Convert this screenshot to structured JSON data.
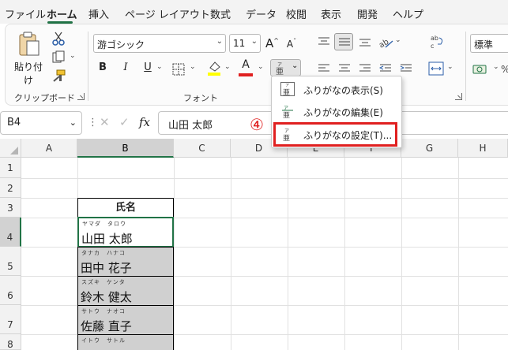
{
  "tabs": [
    "ファイル",
    "ホーム",
    "挿入",
    "ページ レイアウト",
    "数式",
    "データ",
    "校閲",
    "表示",
    "開発",
    "ヘルプ"
  ],
  "active_tab": "ホーム",
  "ribbon": {
    "clipboard": {
      "paste_label": "貼り付け",
      "group_label": "クリップボード"
    },
    "font": {
      "font_name": "游ゴシック",
      "font_size": "11",
      "group_label": "フォント",
      "bold": "B",
      "italic": "I",
      "underline": "U",
      "grow": "A",
      "shrink": "A",
      "font_color": "A"
    },
    "number_format": "標準",
    "accent_color": "#217346",
    "highlight_color": "#ffff00",
    "font_color_swatch": "#e02020"
  },
  "furigana_menu": {
    "items": [
      {
        "label": "ふりがなの表示(S)"
      },
      {
        "label": "ふりがなの編集(E)"
      },
      {
        "label": "ふりがなの設定(T)..."
      }
    ],
    "step_number": "④"
  },
  "formula_bar": {
    "name_box": "B4",
    "cancel": "✕",
    "enter": "✓",
    "fx": "fx",
    "value": "山田 太郎"
  },
  "columns": [
    "A",
    "B",
    "C",
    "D",
    "E",
    "F",
    "G",
    "H"
  ],
  "rows": [
    "1",
    "2",
    "3",
    "4",
    "5",
    "6",
    "7",
    "8"
  ],
  "table": {
    "header": "氏名",
    "names": [
      {
        "ruby": "ヤマダ　タロウ",
        "name": "山田 太郎"
      },
      {
        "ruby": "タナカ　ハナコ",
        "name": "田中 花子"
      },
      {
        "ruby": "スズキ　ケンタ",
        "name": "鈴木 健太"
      },
      {
        "ruby": "サトウ　ナオコ",
        "name": "佐藤 直子"
      },
      {
        "ruby": "イトウ　サトル",
        "name": ""
      }
    ]
  }
}
